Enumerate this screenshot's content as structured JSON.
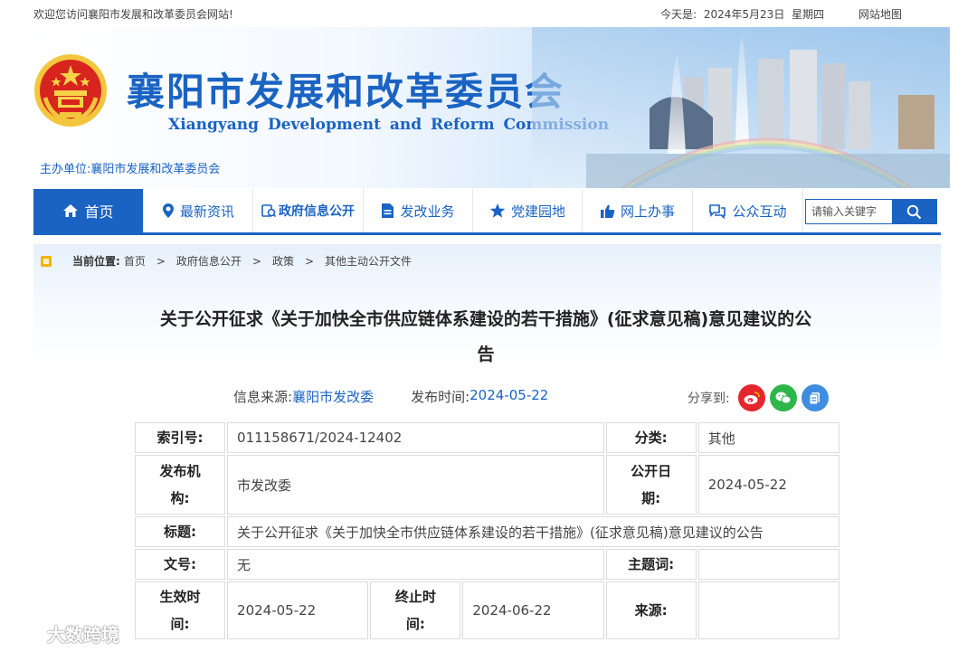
{
  "topbar": {
    "welcome": "欢迎您访问襄阳市发展和改革委员会网站!",
    "today_label": "今天是:",
    "date": "2024年5月23日",
    "weekday": "星期四",
    "sitemap": "网站地图"
  },
  "banner": {
    "title_cn": "襄阳市发展和改革委员会",
    "title_en": "Xiangyang  Development  and  Reform  Commission",
    "host": "主办单位:襄阳市发展和改革委员会"
  },
  "nav": {
    "items": [
      {
        "label": "首页",
        "icon": "home-icon"
      },
      {
        "label": "最新资讯",
        "icon": "location-pin-icon"
      },
      {
        "label": "政府信息公开",
        "icon": "info-open-icon"
      },
      {
        "label": "发改业务",
        "icon": "document-icon"
      },
      {
        "label": "党建园地",
        "icon": "star-icon"
      },
      {
        "label": "网上办事",
        "icon": "thumbs-up-icon"
      },
      {
        "label": "公众互动",
        "icon": "chat-icon"
      }
    ],
    "search_placeholder": "请输入关键字",
    "accent": "#1a63c3"
  },
  "breadcrumb": {
    "label": "当前位置:",
    "items": [
      "首页",
      "政府信息公开",
      "政策",
      "其他主动公开文件"
    ],
    "separator": ">"
  },
  "article": {
    "title_line1": "关于公开征求《关于加快全市供应链体系建设的若干措施》(征求意见稿)意见建议的公",
    "title_line2": "告",
    "source_label": "信息来源:",
    "source": "襄阳市发改委",
    "date_label": "发布时间:",
    "date": "2024-05-22",
    "share_label": "分享到:",
    "share_icons": [
      "weibo-icon",
      "wechat-icon",
      "copy-icon"
    ]
  },
  "info": {
    "index_label": "索引号:",
    "index": "011158671/2024-12402",
    "category_label": "分类:",
    "category": "其他",
    "publisher_label_1": "发布机",
    "publisher_label_2": "构:",
    "publisher": "市发改委",
    "open_date_label_1": "公开日",
    "open_date_label_2": "期:",
    "open_date": "2024-05-22",
    "title_label": "标题:",
    "title": "关于公开征求《关于加快全市供应链体系建设的若干措施》(征求意见稿)意见建议的公告",
    "docno_label": "文号:",
    "docno": "无",
    "subject_label": "主题词:",
    "subject": "",
    "effective_label_1": "生效时",
    "effective_label_2": "间:",
    "effective": "2024-05-22",
    "end_label_1": "终止时",
    "end_label_2": "间:",
    "end": "2024-06-22",
    "origin_label": "来源:",
    "origin": ""
  },
  "watermark": "大数跨境"
}
